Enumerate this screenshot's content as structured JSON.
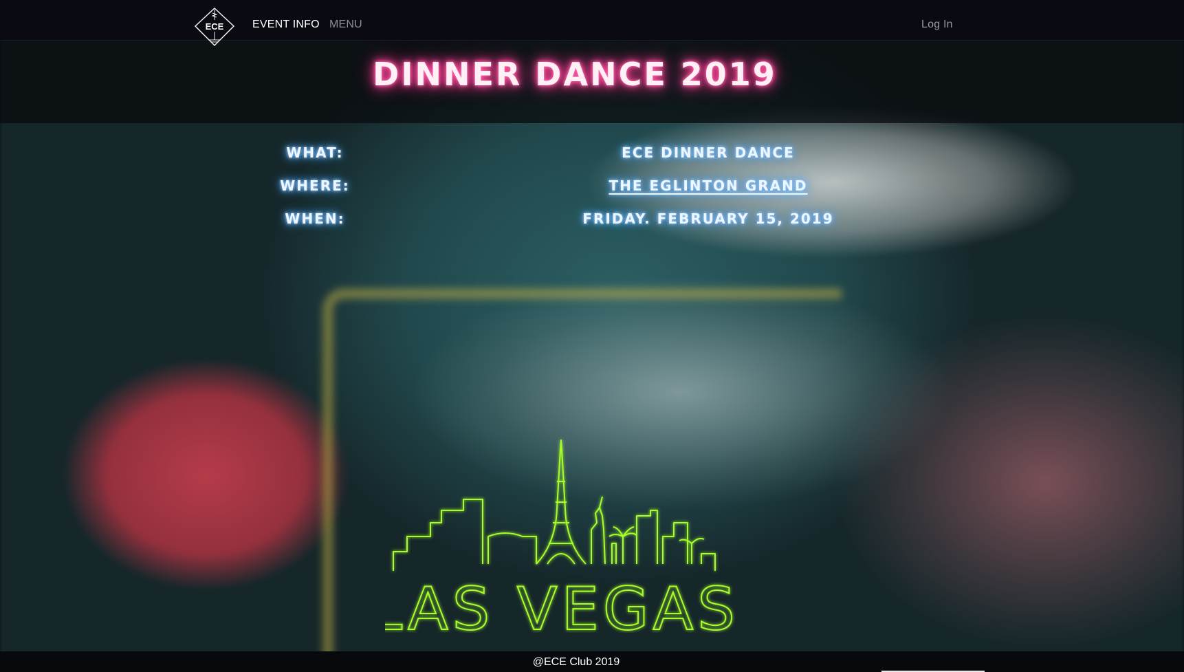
{
  "nav": {
    "logo_text": "ECE",
    "links": [
      {
        "label": "EVENT INFO"
      },
      {
        "label": "MENU"
      }
    ],
    "login_label": "Log In"
  },
  "hero": {
    "title": "DINNER DANCE 2019"
  },
  "info": {
    "rows": [
      {
        "label": "WHAT:",
        "value": "ECE DINNER DANCE"
      },
      {
        "label": "WHERE:",
        "value": "THE EGLINTON GRAND"
      },
      {
        "label": "WHEN:",
        "value": "FRIDAY. FEBRUARY 15, 2019"
      }
    ]
  },
  "logo": {
    "text": "LAS VEGAS",
    "color": "#a6ff2a"
  },
  "footer": {
    "copyright": "@ECE Club 2019"
  },
  "colors": {
    "navbar": "#0a0b12",
    "title_glow": "#ff4d9e",
    "info_glow": "#5fb0ff",
    "vegas_neon": "#a6ff2a"
  }
}
